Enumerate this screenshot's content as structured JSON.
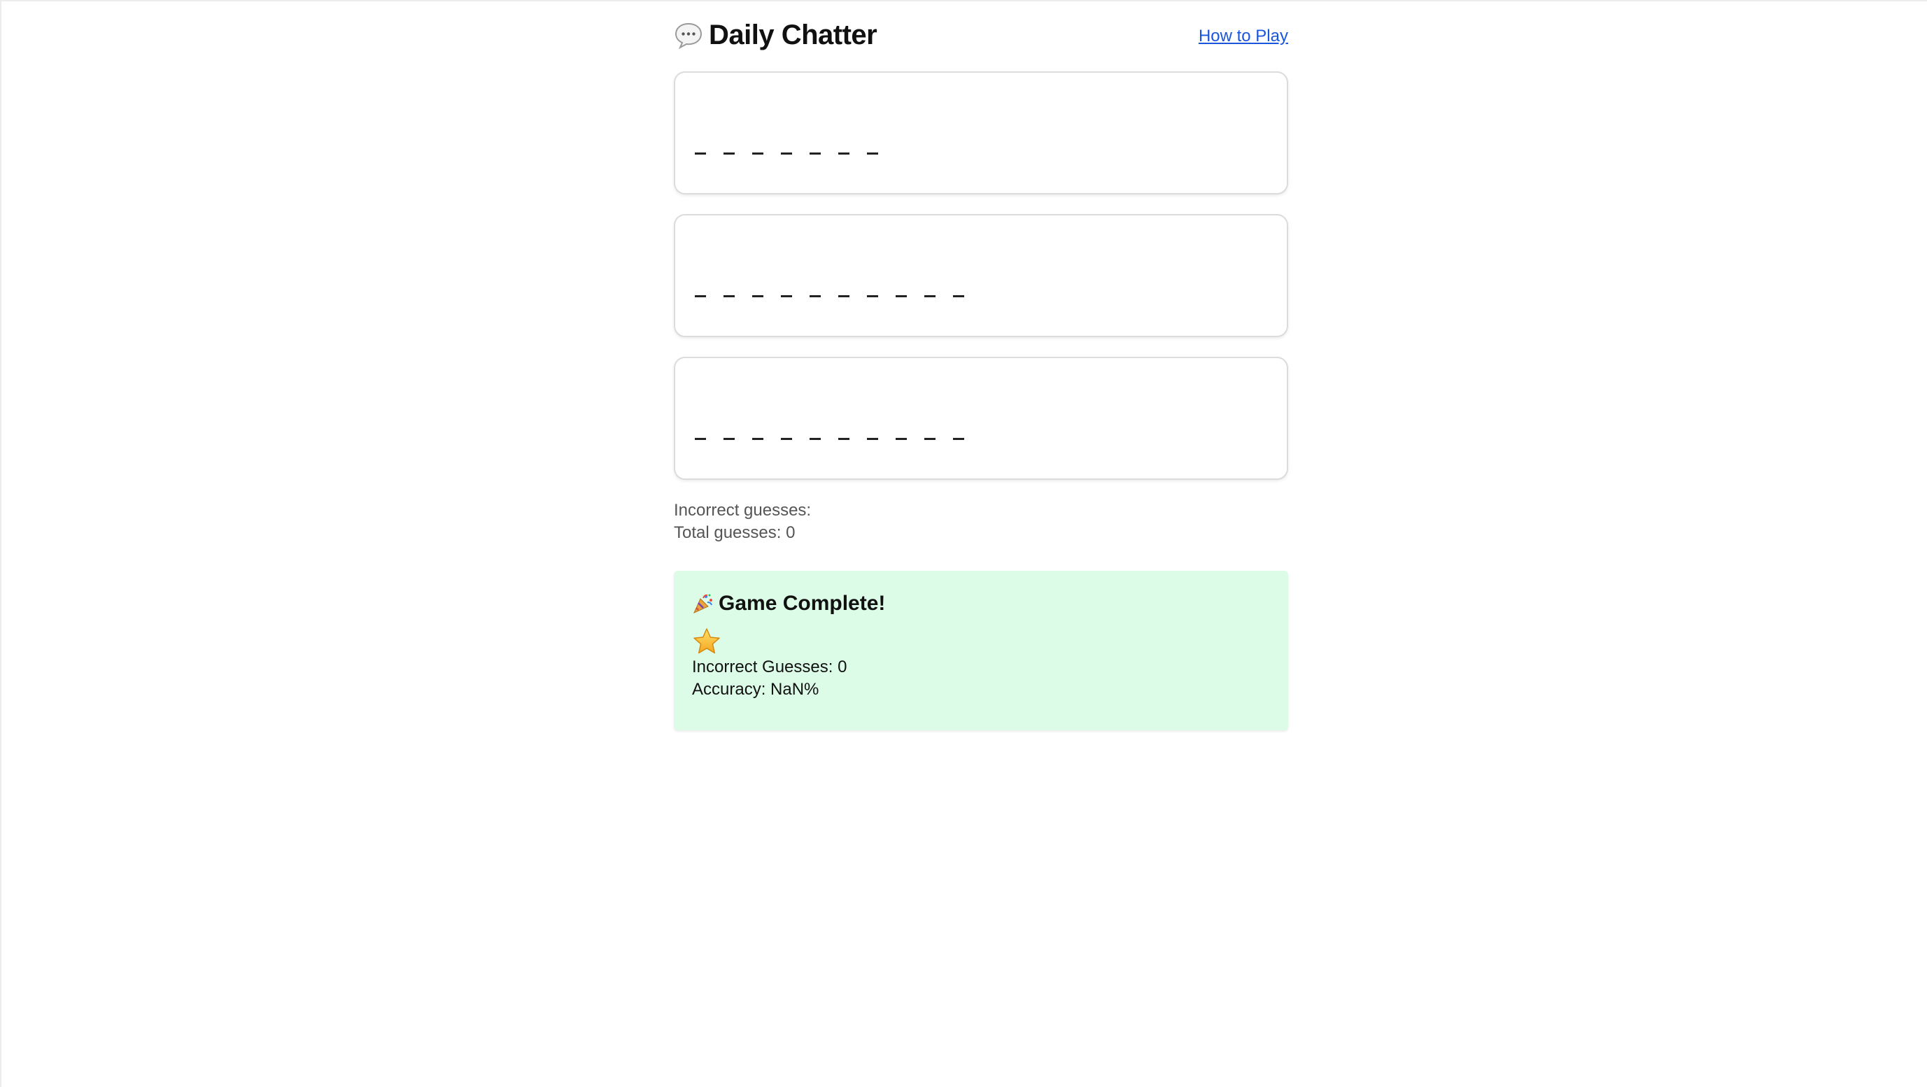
{
  "header": {
    "title": "Daily Chatter",
    "how_to_play": "How to Play"
  },
  "words": [
    {
      "blank_count": 7
    },
    {
      "blank_count": 10
    },
    {
      "blank_count": 10
    }
  ],
  "stats": {
    "incorrect_label": "Incorrect guesses:",
    "total_label": "Total guesses: 0"
  },
  "result": {
    "title": "Game Complete!",
    "incorrect": "Incorrect Guesses: 0",
    "accuracy": "Accuracy: NaN%"
  },
  "colors": {
    "link": "#1a56db",
    "success_bg": "#dcfce7"
  },
  "icons": {
    "title_icon": "speech-bubble-icon",
    "result_icon": "party-popper-icon",
    "rating_icon": "star-icon"
  }
}
